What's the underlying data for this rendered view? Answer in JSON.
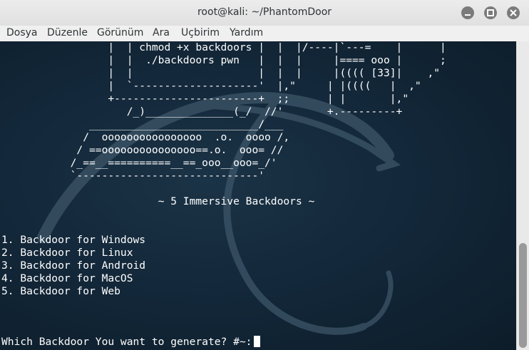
{
  "window": {
    "title": "root@kali: ~/PhantomDoor"
  },
  "menu": [
    "Dosya",
    "Düzenle",
    "Görünüm",
    "Ara",
    "Uçbirim",
    "Yardım"
  ],
  "terminal": {
    "banner": [
      "                 |  | chmod +x backdoors |  |  |/----|`---=    |      |",
      "                 |  |  ./backdoors pwn   |  |  |     |==== ooo |      ;",
      "                 |  |                    |  |  |     |(((( [33]|    ,\"",
      "                 |  `--------------------'  |,\"     | |((((   |  ,\"",
      "                 +-----------------------+  ;;      | |       |,\"",
      "                    /_)______________(_/  //'       +.---------+",
      "              ___________________________/___",
      "             /  oooooooooooooooo  .o.  oooo /,",
      "            / ==ooooooooooooooo==.o.  ooo= //",
      "           /_==__==========__==_ooo__ooo=_/'",
      "           `-----------------------------'"
    ],
    "subtitle": "~ 5 Immersive Backdoors ~",
    "options": [
      "1. Backdoor for Windows",
      "2. Backdoor for Linux",
      "3. Backdoor for Android",
      "4. Backdoor for MacOS",
      "5. Backdoor for Web"
    ],
    "prompt": "Which Backdoor You want to generate? #~:"
  },
  "colors": {
    "terminal_bg": "#13283a",
    "terminal_fg": "#ffffff",
    "titlebar_bg": "#e8e8e8"
  }
}
